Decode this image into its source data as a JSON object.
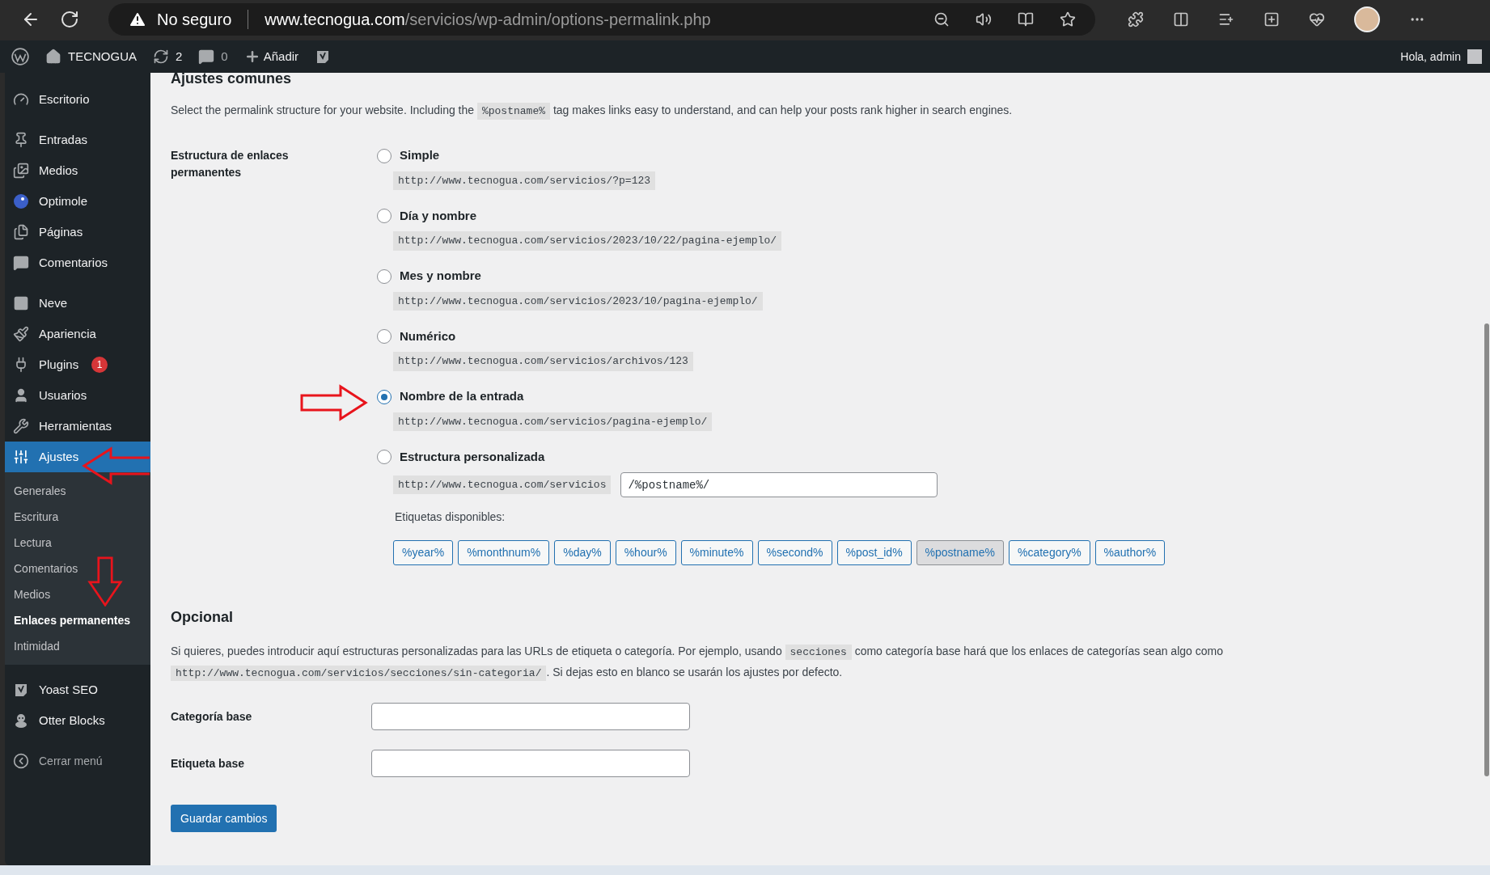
{
  "browser": {
    "security": "No seguro",
    "url_domain": "www.tecnogua.com",
    "url_path": "/servicios/wp-admin/options-permalink.php"
  },
  "admin_bar": {
    "site": "TECNOGUA",
    "updates": "2",
    "comments": "0",
    "new": "Añadir",
    "greeting": "Hola, admin"
  },
  "sidebar": {
    "groups": [
      [
        {
          "label": "Escritorio",
          "selected": false
        }
      ],
      [
        {
          "label": "Entradas",
          "selected": false
        },
        {
          "label": "Medios",
          "selected": false
        },
        {
          "label": "Optimole",
          "selected": false
        },
        {
          "label": "Páginas",
          "selected": false
        },
        {
          "label": "Comentarios",
          "selected": false
        }
      ],
      [
        {
          "label": "Neve",
          "selected": false
        },
        {
          "label": "Apariencia",
          "selected": false
        },
        {
          "label": "Plugins",
          "badge": "1",
          "selected": false
        },
        {
          "label": "Usuarios",
          "selected": false
        },
        {
          "label": "Herramientas",
          "selected": false
        },
        {
          "label": "Ajustes",
          "selected": true,
          "children": [
            {
              "label": "Generales",
              "selected": false
            },
            {
              "label": "Escritura",
              "selected": false
            },
            {
              "label": "Lectura",
              "selected": false
            },
            {
              "label": "Comentarios",
              "selected": false
            },
            {
              "label": "Medios",
              "selected": false
            },
            {
              "label": "Enlaces permanentes",
              "selected": true
            },
            {
              "label": "Intimidad",
              "selected": false
            }
          ]
        }
      ],
      [
        {
          "label": "Yoast SEO",
          "selected": false
        },
        {
          "label": "Otter Blocks",
          "selected": false
        }
      ]
    ],
    "collapse": "Cerrar menú"
  },
  "common": {
    "title": "Ajustes comunes",
    "intro_before": "Select the permalink structure for your website. Including the",
    "intro_code": "%postname%",
    "intro_after": "tag makes links easy to understand, and can help your posts rank higher in search engines."
  },
  "structure": {
    "label": "Estructura de enlaces permanentes",
    "options": [
      {
        "kind": "preset",
        "label": "Simple",
        "example": "http://www.tecnogua.com/servicios/?p=123",
        "selected": false
      },
      {
        "kind": "preset",
        "label": "Día y nombre",
        "example": "http://www.tecnogua.com/servicios/2023/10/22/pagina-ejemplo/",
        "selected": false
      },
      {
        "kind": "preset",
        "label": "Mes y nombre",
        "example": "http://www.tecnogua.com/servicios/2023/10/pagina-ejemplo/",
        "selected": false
      },
      {
        "kind": "preset",
        "label": "Numérico",
        "example": "http://www.tecnogua.com/servicios/archivos/123",
        "selected": false
      },
      {
        "kind": "preset",
        "label": "Nombre de la entrada",
        "example": "http://www.tecnogua.com/servicios/pagina-ejemplo/",
        "selected": true
      },
      {
        "kind": "custom",
        "label": "Estructura personalizada",
        "prefix": "http://www.tecnogua.com/servicios",
        "value": "/%postname%/",
        "selected": false
      }
    ],
    "tags_label": "Etiquetas disponibles:",
    "tags": [
      {
        "label": "%year%",
        "selected": false
      },
      {
        "label": "%monthnum%",
        "selected": false
      },
      {
        "label": "%day%",
        "selected": false
      },
      {
        "label": "%hour%",
        "selected": false
      },
      {
        "label": "%minute%",
        "selected": false
      },
      {
        "label": "%second%",
        "selected": false
      },
      {
        "label": "%post_id%",
        "selected": false
      },
      {
        "label": "%postname%",
        "selected": true
      },
      {
        "label": "%category%",
        "selected": false
      },
      {
        "label": "%author%",
        "selected": false
      }
    ]
  },
  "optional": {
    "title": "Opcional",
    "text_before": "Si quieres, puedes introducir aquí estructuras personalizadas para las URLs de etiqueta o categoría. Por ejemplo, usando",
    "text_code": "secciones",
    "text_middle": "como categoría base hará que los enlaces de categorías sean algo como",
    "text_url": "http://www.tecnogua.com/servicios/secciones/sin-categoria/",
    "text_after": ". Si dejas esto en blanco se usarán los ajustes por defecto.",
    "fields": [
      {
        "label": "Categoría base"
      },
      {
        "label": "Etiqueta base"
      }
    ]
  },
  "save_button": "Guardar cambios"
}
